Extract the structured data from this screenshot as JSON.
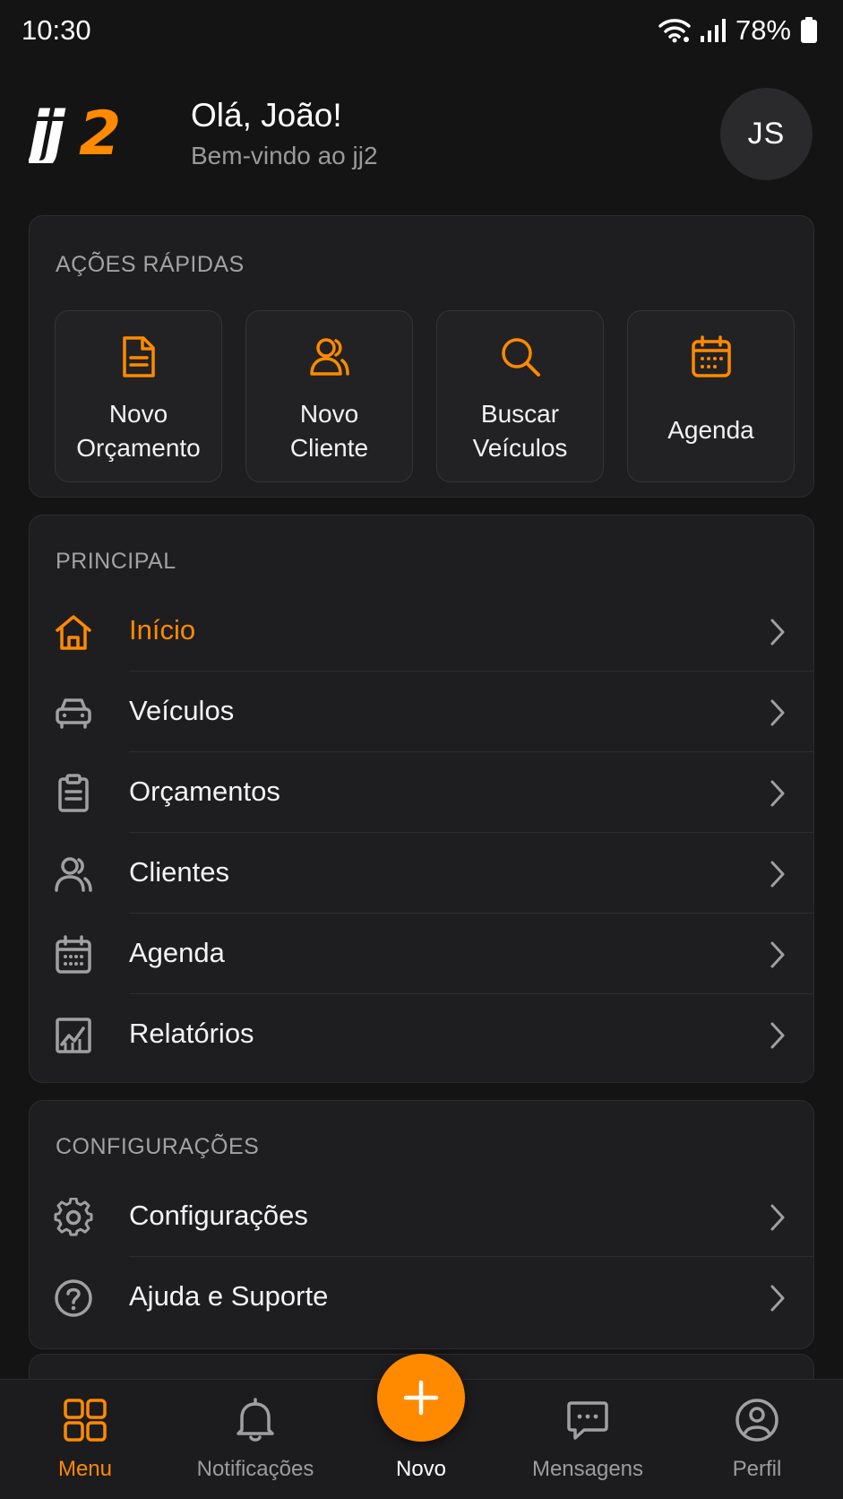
{
  "status_bar": {
    "time": "10:30",
    "battery": "78%"
  },
  "header": {
    "logo_text": "jj2",
    "greeting": "Olá, João!",
    "subtitle": "Bem-vindo ao jj2",
    "avatar_initials": "JS"
  },
  "quick_actions": {
    "title": "AÇÕES RÁPIDAS",
    "items": [
      {
        "label": "Novo\nOrçamento",
        "icon": "document-icon"
      },
      {
        "label": "Novo\nCliente",
        "icon": "users-icon"
      },
      {
        "label": "Buscar\nVeículos",
        "icon": "search-icon"
      },
      {
        "label": "Agenda",
        "icon": "calendar-icon"
      }
    ]
  },
  "principal": {
    "title": "PRINCIPAL",
    "items": [
      {
        "label": "Início",
        "icon": "home-icon",
        "active": true
      },
      {
        "label": "Veículos",
        "icon": "car-icon"
      },
      {
        "label": "Orçamentos",
        "icon": "clipboard-icon"
      },
      {
        "label": "Clientes",
        "icon": "users-icon"
      },
      {
        "label": "Agenda",
        "icon": "calendar-icon"
      },
      {
        "label": "Relatórios",
        "icon": "chart-icon"
      }
    ]
  },
  "configuracoes": {
    "title": "CONFIGURAÇÕES",
    "items": [
      {
        "label": "Configurações",
        "icon": "gear-icon"
      },
      {
        "label": "Ajuda e Suporte",
        "icon": "help-icon"
      }
    ]
  },
  "bottom_nav": {
    "items": [
      {
        "label": "Menu",
        "icon": "grid-icon",
        "active": true
      },
      {
        "label": "Notificações",
        "icon": "bell-icon"
      },
      {
        "label": "Novo",
        "icon": "plus-icon"
      },
      {
        "label": "Mensagens",
        "icon": "chat-icon"
      },
      {
        "label": "Perfil",
        "icon": "profile-icon"
      }
    ]
  },
  "colors": {
    "accent": "#ff8a00",
    "background": "#141415",
    "card": "#1e1e20",
    "muted_text": "#9a9a9c"
  }
}
